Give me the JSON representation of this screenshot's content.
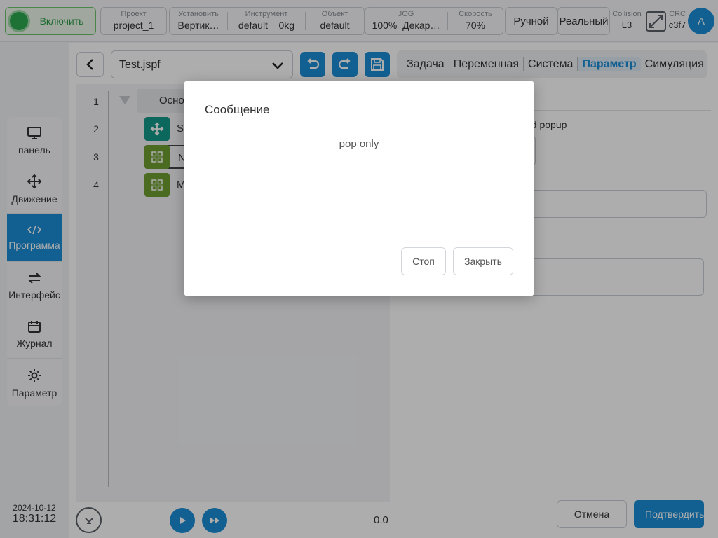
{
  "topbar": {
    "enable_label": "Включить",
    "project": {
      "caption": "Проект",
      "value": "project_1"
    },
    "install": {
      "caption": "Установить",
      "value": "Вертик…"
    },
    "tool": {
      "caption": "Инструмент",
      "value": "default",
      "payload": "0kg"
    },
    "object": {
      "caption": "Объект",
      "value": "default"
    },
    "jog": {
      "caption": "JOG",
      "value": "100%",
      "frame": "Декар…"
    },
    "speed": {
      "caption": "Скорость",
      "value": "70%"
    },
    "manual_label": "Ручной",
    "real_label": "Реальный",
    "collision": {
      "caption": "Collision",
      "value": "L3"
    },
    "crc": {
      "caption": "CRC",
      "value": "c3f7"
    },
    "avatar_letter": "A"
  },
  "sidebar": {
    "items": [
      {
        "label": "панель",
        "icon": "monitor-icon"
      },
      {
        "label": "Движение",
        "icon": "move-icon"
      },
      {
        "label": "Программа",
        "icon": "code-icon",
        "active": true
      },
      {
        "label": "Интерфейс",
        "icon": "swap-icon"
      },
      {
        "label": "Журнал",
        "icon": "calendar-icon"
      },
      {
        "label": "Параметр",
        "icon": "gear-icon"
      }
    ],
    "date": "2024-10-12",
    "time": "18:31:12"
  },
  "editor": {
    "file_name": "Test.jspf",
    "line_numbers": [
      "1",
      "2",
      "3",
      "4"
    ],
    "root_label": "Осно",
    "node_labels": [
      "S",
      "N",
      "M"
    ]
  },
  "tabs": [
    "Задача",
    "Переменная",
    "Система",
    "Параметр",
    "Симуляция"
  ],
  "right_panel": {
    "popup_text": "nd popup"
  },
  "footer": {
    "progress_value": "0.0",
    "cancel_label": "Отмена",
    "confirm_label": "Подтвердить"
  },
  "dialog": {
    "title": "Сообщение",
    "message": "pop only",
    "stop_label": "Стоп",
    "close_label": "Закрыть"
  },
  "colors": {
    "accent": "#1b8ed8",
    "enable_green": "#2fa84f",
    "move_node": "#13998a",
    "block_node": "#6fa030"
  }
}
